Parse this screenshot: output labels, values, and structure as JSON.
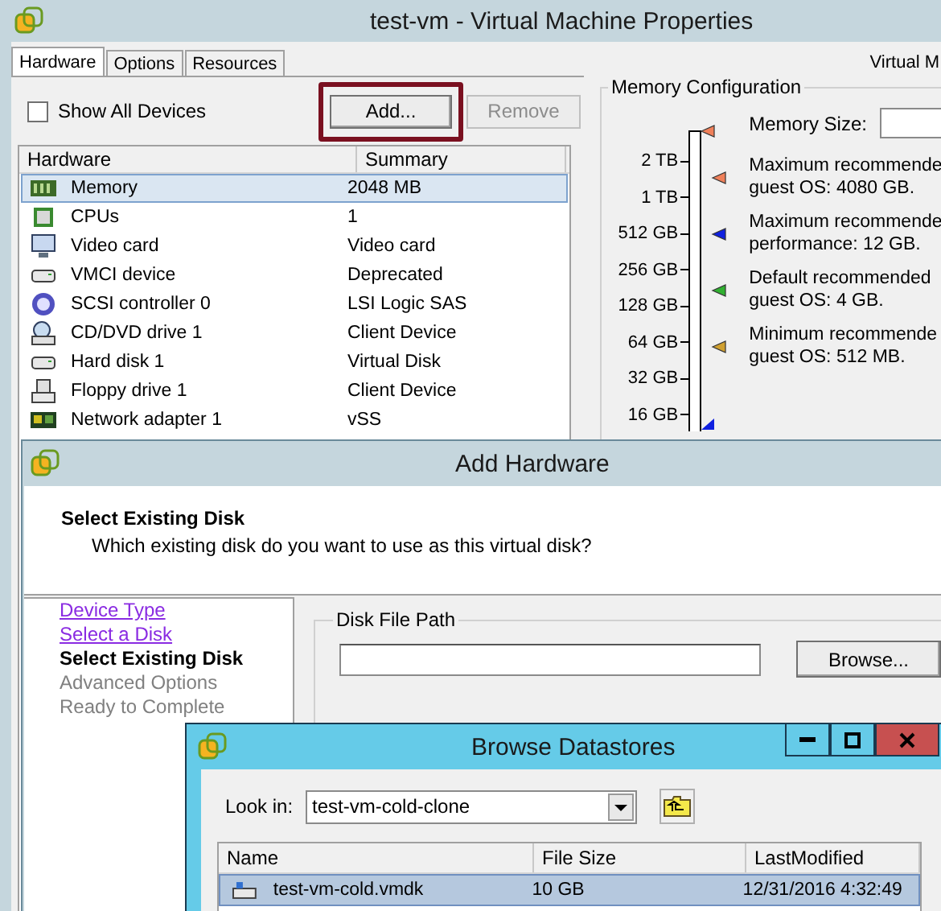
{
  "properties_window": {
    "title": "test-vm - Virtual Machine Properties",
    "right_text": "Virtual M",
    "tabs": [
      {
        "label": "Hardware",
        "selected": true
      },
      {
        "label": "Options",
        "selected": false
      },
      {
        "label": "Resources",
        "selected": false
      }
    ],
    "show_all_devices": {
      "label": "Show All Devices",
      "checked": false
    },
    "add_button": {
      "label": "Add...",
      "highlighted": true
    },
    "remove_button": {
      "label": "Remove",
      "disabled": true
    },
    "hardware_table": {
      "columns": [
        "Hardware",
        "Summary"
      ],
      "rows": [
        {
          "kind": "memory",
          "hardware": "Memory",
          "summary": "2048 MB",
          "selected": true
        },
        {
          "kind": "cpu",
          "hardware": "CPUs",
          "summary": "1",
          "selected": false
        },
        {
          "kind": "video",
          "hardware": "Video card",
          "summary": "Video card",
          "selected": false
        },
        {
          "kind": "device",
          "hardware": "VMCI device",
          "summary": "Deprecated",
          "selected": false
        },
        {
          "kind": "scsi",
          "hardware": "SCSI controller 0",
          "summary": "LSI Logic SAS",
          "selected": false
        },
        {
          "kind": "cdrom",
          "hardware": "CD/DVD drive 1",
          "summary": "Client Device",
          "selected": false
        },
        {
          "kind": "device",
          "hardware": "Hard disk 1",
          "summary": "Virtual Disk",
          "selected": false
        },
        {
          "kind": "floppy",
          "hardware": "Floppy drive 1",
          "summary": "Client Device",
          "selected": false
        },
        {
          "kind": "network",
          "hardware": "Network adapter 1",
          "summary": "vSS",
          "selected": false
        }
      ]
    },
    "memory_configuration": {
      "title": "Memory Configuration",
      "memory_size_label": "Memory Size:",
      "scale": [
        "2 TB",
        "1 TB",
        "512 GB",
        "256 GB",
        "128 GB",
        "64 GB",
        "32 GB",
        "16 GB"
      ],
      "recommendations": [
        {
          "color": "#f0805a",
          "lines": [
            "Maximum recommende",
            "guest OS: 4080 GB."
          ]
        },
        {
          "color": "#1020e0",
          "lines": [
            "Maximum recommende",
            "performance: 12 GB."
          ]
        },
        {
          "color": "#30b030",
          "lines": [
            "Default recommended",
            "guest OS: 4 GB."
          ]
        },
        {
          "color": "#d0a030",
          "lines": [
            "Minimum recommende",
            "guest OS: 512 MB."
          ]
        }
      ]
    }
  },
  "add_hardware": {
    "title": "Add Hardware",
    "heading": "Select Existing Disk",
    "subheading": "Which existing disk do you want to use as this virtual disk?",
    "steps": [
      {
        "label": "Device Type",
        "kind": "visited"
      },
      {
        "label": "Select a Disk",
        "kind": "visited"
      },
      {
        "label": "Select Existing Disk",
        "kind": "current"
      },
      {
        "label": "Advanced Options",
        "kind": "pending"
      },
      {
        "label": "Ready to Complete",
        "kind": "pending"
      }
    ],
    "disk_file_path": {
      "title": "Disk File Path",
      "browse_button": "Browse..."
    }
  },
  "browse_datastores": {
    "title": "Browse Datastores",
    "look_in_label": "Look in:",
    "look_in_value": "test-vm-cold-clone",
    "columns": [
      "Name",
      "File Size",
      "LastModified"
    ],
    "files": [
      {
        "name": "test-vm-cold.vmdk",
        "size": "10 GB",
        "modified": "12/31/2016 4:32:49",
        "selected": true
      }
    ]
  }
}
